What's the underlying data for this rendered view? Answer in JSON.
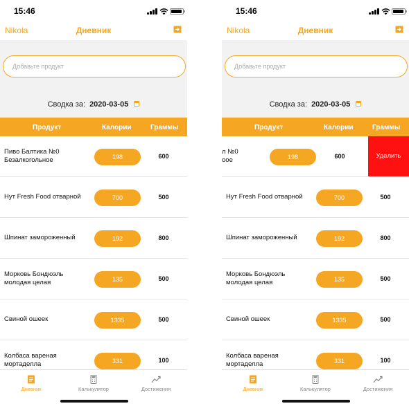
{
  "colors": {
    "accent": "#f5a623",
    "delete": "#ff1111"
  },
  "status": {
    "time": "15:46"
  },
  "nav": {
    "user": "Nikola",
    "title": "Дневник",
    "logout_icon": "logout-icon"
  },
  "search": {
    "placeholder": "Добавьте продукт",
    "value": ""
  },
  "summary": {
    "label": "Сводка за:",
    "date": "2020-03-05",
    "calendar_icon": "calendar-icon"
  },
  "table": {
    "headers": {
      "product": "Продукт",
      "calories": "Калории",
      "grams": "Граммы"
    },
    "rows": [
      {
        "name": "Пиво Балтика №0 Безалкогольное",
        "calories": "198",
        "grams": "600"
      },
      {
        "name": "Нут Fresh Food отварной",
        "calories": "700",
        "grams": "500"
      },
      {
        "name": "Шпинат замороженный",
        "calories": "192",
        "grams": "800"
      },
      {
        "name": "Морковь Бондюэль молодая целая",
        "calories": "135",
        "grams": "500"
      },
      {
        "name": "Свиной ошеек",
        "calories": "1335",
        "grams": "500"
      },
      {
        "name": "Колбаса вареная мортаделла",
        "calories": "331",
        "grams": "100"
      }
    ],
    "swiped_name_visible": "л №0 оое",
    "delete_label": "Удалить"
  },
  "tabs": [
    {
      "label": "Дневник",
      "icon": "diary-icon",
      "active": true
    },
    {
      "label": "Калькулятор",
      "icon": "calculator-icon",
      "active": false
    },
    {
      "label": "Достижения",
      "icon": "achievements-icon",
      "active": false
    }
  ]
}
